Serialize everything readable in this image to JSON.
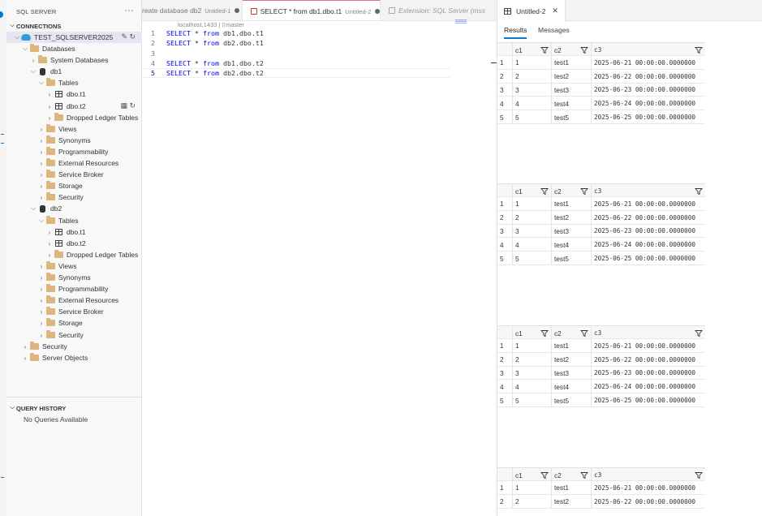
{
  "sidebar": {
    "title": "SQL SERVER",
    "more": "···",
    "connections_title": "CONNECTIONS",
    "server_name": "TEST_SQLSERVER2025",
    "tree": [
      {
        "label": "Databases",
        "depth": 1,
        "icon": "folder",
        "open": true
      },
      {
        "label": "System Databases",
        "depth": 2,
        "icon": "folder",
        "open": false
      },
      {
        "label": "db1",
        "depth": 2,
        "icon": "database",
        "open": true
      },
      {
        "label": "Tables",
        "depth": 3,
        "icon": "folder",
        "open": true
      },
      {
        "label": "dbo.t1",
        "depth": 4,
        "icon": "table",
        "open": false
      },
      {
        "label": "dbo.t2",
        "depth": 4,
        "icon": "table",
        "open": false,
        "actions": true
      },
      {
        "label": "Dropped Ledger Tables",
        "depth": 4,
        "icon": "folder",
        "open": false
      },
      {
        "label": "Views",
        "depth": 3,
        "icon": "folder",
        "open": false
      },
      {
        "label": "Synonyms",
        "depth": 3,
        "icon": "folder",
        "open": false
      },
      {
        "label": "Programmability",
        "depth": 3,
        "icon": "folder",
        "open": false
      },
      {
        "label": "External Resources",
        "depth": 3,
        "icon": "folder",
        "open": false
      },
      {
        "label": "Service Broker",
        "depth": 3,
        "icon": "folder",
        "open": false
      },
      {
        "label": "Storage",
        "depth": 3,
        "icon": "folder",
        "open": false
      },
      {
        "label": "Security",
        "depth": 3,
        "icon": "folder",
        "open": false
      },
      {
        "label": "db2",
        "depth": 2,
        "icon": "database",
        "open": true
      },
      {
        "label": "Tables",
        "depth": 3,
        "icon": "folder",
        "open": true
      },
      {
        "label": "dbo.t1",
        "depth": 4,
        "icon": "table",
        "open": false
      },
      {
        "label": "dbo.t2",
        "depth": 4,
        "icon": "table",
        "open": false
      },
      {
        "label": "Dropped Ledger Tables",
        "depth": 4,
        "icon": "folder",
        "open": false
      },
      {
        "label": "Views",
        "depth": 3,
        "icon": "folder",
        "open": false
      },
      {
        "label": "Synonyms",
        "depth": 3,
        "icon": "folder",
        "open": false
      },
      {
        "label": "Programmability",
        "depth": 3,
        "icon": "folder",
        "open": false
      },
      {
        "label": "External Resources",
        "depth": 3,
        "icon": "folder",
        "open": false
      },
      {
        "label": "Service Broker",
        "depth": 3,
        "icon": "folder",
        "open": false
      },
      {
        "label": "Storage",
        "depth": 3,
        "icon": "folder",
        "open": false
      },
      {
        "label": "Security",
        "depth": 3,
        "icon": "folder",
        "open": false
      },
      {
        "label": "Security",
        "depth": 1,
        "icon": "folder",
        "open": false
      },
      {
        "label": "Server Objects",
        "depth": 1,
        "icon": "folder",
        "open": false
      }
    ],
    "query_history_title": "QUERY HISTORY",
    "query_history_empty": "No Queries Available"
  },
  "editor": {
    "tabs": [
      {
        "label": "reate database db2",
        "sub": "Untitled-1",
        "dirty": true
      },
      {
        "label": "SELECT * from db1.dbo.t1",
        "sub": "Untitled-2",
        "dirty": true,
        "active": true
      },
      {
        "label": "Extension: SQL Server (mss",
        "sub": "",
        "dirty": false,
        "italic": true
      }
    ],
    "connection_info": "localhost,1433 | ⌷master",
    "lines": [
      {
        "n": "1",
        "kw1": "SELECT",
        "mid": " * ",
        "kw2": "from",
        "rest": " db1.dbo.t1"
      },
      {
        "n": "2",
        "kw1": "SELECT",
        "mid": " * ",
        "kw2": "from",
        "rest": " db2.dbo.t1"
      },
      {
        "n": "3",
        "kw1": "",
        "mid": "",
        "kw2": "",
        "rest": ""
      },
      {
        "n": "4",
        "kw1": "SELECT",
        "mid": " * ",
        "kw2": "from",
        "rest": " db1.dbo.t2"
      },
      {
        "n": "5",
        "kw1": "SELECT",
        "mid": " * ",
        "kw2": "from",
        "rest": " db2.dbo.t2"
      }
    ]
  },
  "results": {
    "tab_label": "Untitled-2",
    "tab_close": "✕",
    "subtabs": [
      "Results",
      "Messages"
    ],
    "columns": [
      "c1",
      "c2",
      "c3"
    ],
    "grids": [
      {
        "rows": [
          [
            "1",
            "1",
            "test1",
            "2025-06-21 00:00:00.0000000"
          ],
          [
            "2",
            "2",
            "test2",
            "2025-06-22 00:00:00.0000000"
          ],
          [
            "3",
            "3",
            "test3",
            "2025-06-23 00:00:00.0000000"
          ],
          [
            "4",
            "4",
            "test4",
            "2025-06-24 00:00:00.0000000"
          ],
          [
            "5",
            "5",
            "test5",
            "2025-06-25 00:00:00.0000000"
          ]
        ]
      },
      {
        "rows": [
          [
            "1",
            "1",
            "test1",
            "2025-06-21 00:00:00.0000000"
          ],
          [
            "2",
            "2",
            "test2",
            "2025-06-22 00:00:00.0000000"
          ],
          [
            "3",
            "3",
            "test3",
            "2025-06-23 00:00:00.0000000"
          ],
          [
            "4",
            "4",
            "test4",
            "2025-06-24 00:00:00.0000000"
          ],
          [
            "5",
            "5",
            "test5",
            "2025-06-25 00:00:00.0000000"
          ]
        ]
      },
      {
        "rows": [
          [
            "1",
            "1",
            "test1",
            "2025-06-21 00:00:00.0000000"
          ],
          [
            "2",
            "2",
            "test2",
            "2025-06-22 00:00:00.0000000"
          ],
          [
            "3",
            "3",
            "test3",
            "2025-06-23 00:00:00.0000000"
          ],
          [
            "4",
            "4",
            "test4",
            "2025-06-24 00:00:00.0000000"
          ],
          [
            "5",
            "5",
            "test5",
            "2025-06-25 00:00:00.0000000"
          ]
        ]
      },
      {
        "rows": [
          [
            "1",
            "1",
            "test1",
            "2025-06-21 00:00:00.0000000"
          ],
          [
            "2",
            "2",
            "test2",
            "2025-06-22 00:00:00.0000000"
          ]
        ]
      }
    ]
  },
  "colors": {
    "accent": "#0078d4",
    "keyword": "#0000ff",
    "folder": "#dcb67a",
    "active_tab_border": "#e06c9f"
  }
}
